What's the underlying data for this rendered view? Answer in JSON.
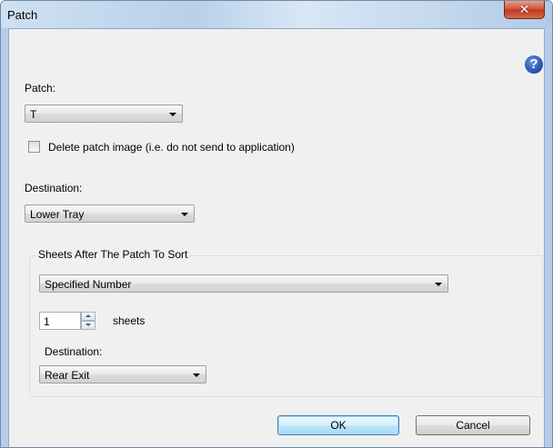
{
  "window": {
    "title": "Patch",
    "close_glyph": "✕"
  },
  "help": {
    "glyph": "?"
  },
  "patch": {
    "label": "Patch:",
    "selected": "T"
  },
  "delete_patch": {
    "label": "Delete patch image (i.e. do not send to application)",
    "checked": false
  },
  "destination": {
    "label": "Destination:",
    "selected": "Lower Tray"
  },
  "sheets_group": {
    "title": "Sheets After The Patch To Sort",
    "mode_selected": "Specified Number",
    "count_value": "1",
    "count_unit": "sheets",
    "destination_label": "Destination:",
    "destination_selected": "Rear Exit"
  },
  "buttons": {
    "ok": "OK",
    "cancel": "Cancel"
  }
}
